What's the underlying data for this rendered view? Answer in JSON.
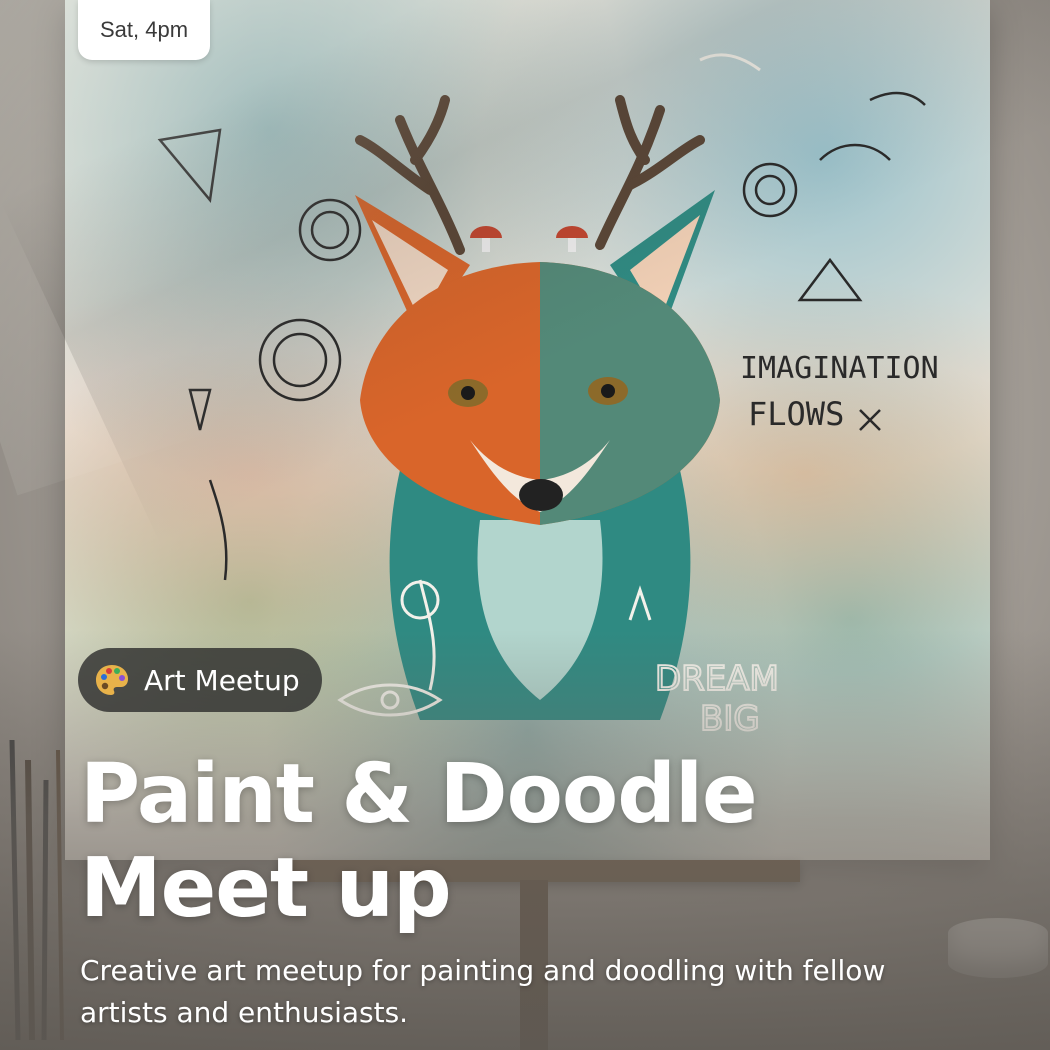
{
  "event": {
    "date": "Sat, 4pm",
    "category": "Art Meetup",
    "category_icon": "artist-palette-icon",
    "title": "Paint & Doodle Meet up",
    "description": "Creative art meetup for painting and doodling with fellow artists and enthusiasts."
  },
  "artwork": {
    "text_1": "IMAGINATION",
    "text_2": "FLOWS",
    "text_3": "DREAM",
    "text_4": "BIG"
  },
  "colors": {
    "chip_bg": "#ffffff",
    "pill_bg": "#282828",
    "text_light": "#ffffff",
    "fox_orange": "#d9652a",
    "fox_teal": "#2f8a82"
  }
}
